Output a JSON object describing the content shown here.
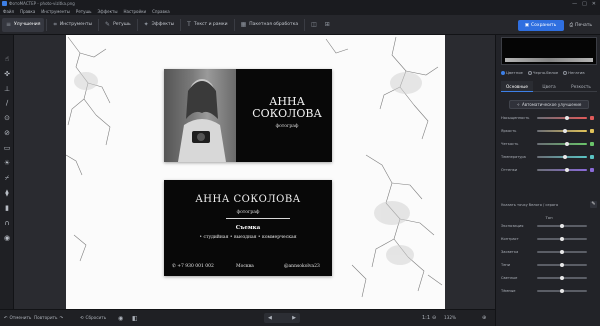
{
  "window": {
    "title": "ФотоМАСТЕР - photo-vizitka.png",
    "controls": [
      "—",
      "□",
      "✕"
    ]
  },
  "menu": [
    "Файл",
    "Правка",
    "Инструменты",
    "Ретушь",
    "Эффекты",
    "Настройки",
    "Справка"
  ],
  "toolbar": {
    "tabs": [
      {
        "label": "Улучшения",
        "icon": "sliders-icon",
        "active": true
      },
      {
        "label": "Инструменты",
        "icon": "crop-icon"
      },
      {
        "label": "Ретушь",
        "icon": "brush-icon"
      },
      {
        "label": "Эффекты",
        "icon": "effects-icon"
      },
      {
        "label": "Текст и рамки",
        "icon": "text-icon"
      },
      {
        "label": "Пакетная обработка",
        "icon": "batch-icon"
      }
    ],
    "save_label": "Сохранить",
    "print_label": "Печать"
  },
  "card1": {
    "name_line1": "АННА",
    "name_line2": "СОКОЛОВА",
    "profession": "фотограф"
  },
  "card2": {
    "name": "АННА СОКОЛОВА",
    "profession": "фотограф",
    "section_title": "Съемка",
    "services": "• студийная  • выездная  • коммерческая",
    "phone": "+7 930 001 002",
    "city": "Москва",
    "handle": "@annsokolva23"
  },
  "panel": {
    "modes": [
      "Цветное",
      "Черно-белое",
      "Негатив"
    ],
    "tabs": [
      "Основные",
      "Цвета",
      "Резкость"
    ],
    "auto_label": "Автоматическое улучшение",
    "sliders1": [
      {
        "label": "Насыщенность",
        "value": 0.6,
        "color": "#e05a5a"
      },
      {
        "label": "Яркость",
        "value": 0.55,
        "color": "#e0c25a"
      },
      {
        "label": "Четкость",
        "value": 0.6,
        "color": "#6ac46a"
      },
      {
        "label": "Температура",
        "value": 0.55,
        "color": "#5ac4c4"
      },
      {
        "label": "Оттенки",
        "value": 0.6,
        "color": "#8a6ad8"
      }
    ],
    "picker_label": "Указать точку белого / серого",
    "tone_heading": "Тон",
    "sliders2": [
      {
        "label": "Экспозиция",
        "value": 0.5
      },
      {
        "label": "Контраст",
        "value": 0.5
      },
      {
        "label": "Засветка",
        "value": 0.5
      },
      {
        "label": "Тени",
        "value": 0.5
      },
      {
        "label": "Светлые",
        "value": 0.5
      },
      {
        "label": "Тёмные",
        "value": 0.5
      }
    ]
  },
  "status": {
    "undo_label": "Отменить",
    "redo_label": "Повторить",
    "reset_label": "Сбросить",
    "fit_label": "1:1",
    "zoom_label": "132%"
  },
  "colors": {
    "accent": "#2f6fe0",
    "canvas": "#fbfbfb",
    "card": "#080808"
  }
}
